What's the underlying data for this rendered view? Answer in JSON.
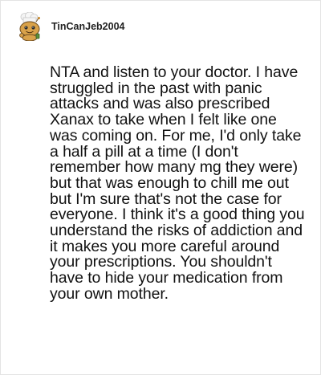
{
  "comment": {
    "author": "TinCanJeb2004",
    "avatar_icon": "snoo-avatar-icon",
    "body": "NTA and listen to your doctor. I have struggled in the past with panic attacks and was also prescribed Xanax to take when I felt like one was coming on. For me, I'd only take a half a pill at a time (I don't remember how many mg they were) but that was enough to chill me out but I'm sure that's not the case for everyone. I think it's a good thing you understand the risks of addiction and it makes you more careful around your prescriptions. You shouldn't have to hide your medication from your own mother."
  }
}
